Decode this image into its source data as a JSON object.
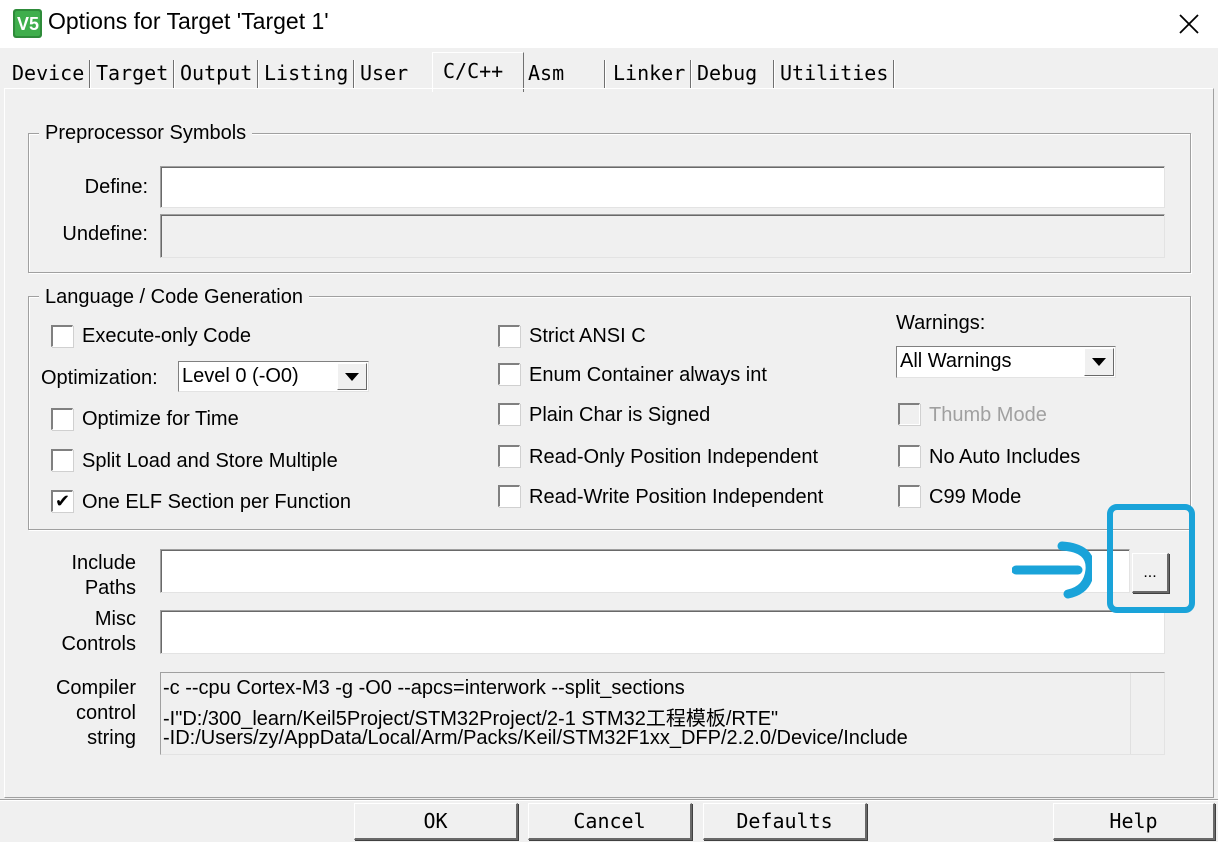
{
  "window": {
    "title": "Options for Target 'Target 1'",
    "app_icon_text": "V5"
  },
  "tabs": [
    {
      "label": "Device"
    },
    {
      "label": "Target"
    },
    {
      "label": "Output"
    },
    {
      "label": "Listing"
    },
    {
      "label": "User"
    },
    {
      "label": "C/C++",
      "active": true
    },
    {
      "label": "Asm"
    },
    {
      "label": "Linker"
    },
    {
      "label": "Debug"
    },
    {
      "label": "Utilities"
    }
  ],
  "preprocessor": {
    "group_title": "Preprocessor Symbols",
    "define_label": "Define:",
    "define_value": "",
    "undefine_label": "Undefine:",
    "undefine_value": ""
  },
  "language": {
    "group_title": "Language / Code Generation",
    "execute_only": {
      "label": "Execute-only Code",
      "checked": false
    },
    "optimization_label": "Optimization:",
    "optimization_value": "Level 0 (-O0)",
    "optimize_time": {
      "label": "Optimize for Time",
      "checked": false
    },
    "split_load": {
      "label": "Split Load and Store Multiple",
      "checked": false
    },
    "one_elf": {
      "label": "One ELF Section per Function",
      "checked": true
    },
    "strict_ansi": {
      "label": "Strict ANSI C",
      "checked": false
    },
    "enum_container": {
      "label": "Enum Container always int",
      "checked": false
    },
    "plain_char": {
      "label": "Plain Char is Signed",
      "checked": false
    },
    "ro_pi": {
      "label": "Read-Only Position Independent",
      "checked": false
    },
    "rw_pi": {
      "label": "Read-Write Position Independent",
      "checked": false
    },
    "warnings_label": "Warnings:",
    "warnings_value": "All Warnings",
    "thumb_mode": {
      "label": "Thumb Mode",
      "checked": false,
      "disabled": true
    },
    "no_auto_includes": {
      "label": "No Auto Includes",
      "checked": false
    },
    "c99_mode": {
      "label": "C99 Mode",
      "checked": false
    }
  },
  "include_paths": {
    "label_line1": "Include",
    "label_line2": "Paths",
    "value": "",
    "browse_label": "..."
  },
  "misc_controls": {
    "label_line1": "Misc",
    "label_line2": "Controls",
    "value": ""
  },
  "compiler_control": {
    "label_line1": "Compiler",
    "label_line2": "control",
    "label_line3": "string",
    "lines": [
      "-c --cpu Cortex-M3 -g -O0 --apcs=interwork --split_sections",
      "-I\"D:/300_learn/Keil5Project/STM32Project/2-1 STM32工程模板/RTE\"",
      "-ID:/Users/zy/AppData/Local/Arm/Packs/Keil/STM32F1xx_DFP/2.2.0/Device/Include"
    ]
  },
  "buttons": {
    "ok": "OK",
    "cancel": "Cancel",
    "defaults": "Defaults",
    "help": "Help"
  },
  "colors": {
    "annotation": "#1aa3d9"
  }
}
